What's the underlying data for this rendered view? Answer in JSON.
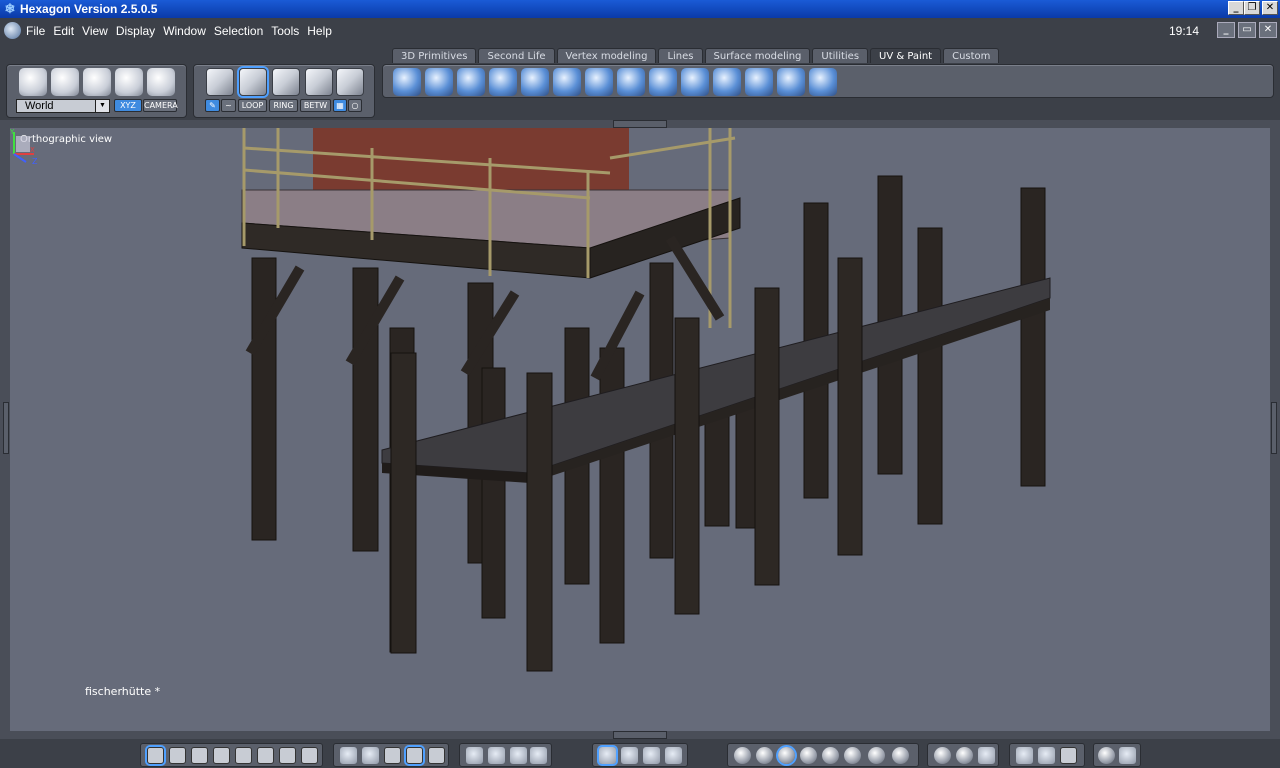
{
  "window": {
    "title": "Hexagon Version 2.5.0.5",
    "icon": "snowflake-icon",
    "controls": [
      "_",
      "❐",
      "✕"
    ]
  },
  "menubar": {
    "items": [
      "File",
      "Edit",
      "View",
      "Display",
      "Window",
      "Selection",
      "Tools",
      "Help"
    ],
    "clock": "19:14",
    "controls": [
      "_",
      "▭",
      "✕"
    ]
  },
  "tabs": [
    {
      "label": "3D Primitives"
    },
    {
      "label": "Second Life"
    },
    {
      "label": "Vertex modeling"
    },
    {
      "label": "Lines"
    },
    {
      "label": "Surface modeling"
    },
    {
      "label": "Utilities"
    },
    {
      "label": "UV & Paint",
      "active": true
    },
    {
      "label": "Custom"
    }
  ],
  "left_panel": {
    "coord_space": "World",
    "xyz_label": "XYZ",
    "camera_label": "CAMERA"
  },
  "selection_panel": {
    "loop": "LOOP",
    "ring": "RING",
    "betw": "BETW"
  },
  "viewport": {
    "label": "Orthographic view",
    "object_name": "fischerhütte *",
    "axis": {
      "y": "Y",
      "x": "X",
      "z": "Z"
    }
  },
  "colors": {
    "accent": "#4fa0ff",
    "ui_bg": "#3c4048",
    "viewport_bg": "#666b7a",
    "titlebar": "#0a3aa8"
  }
}
